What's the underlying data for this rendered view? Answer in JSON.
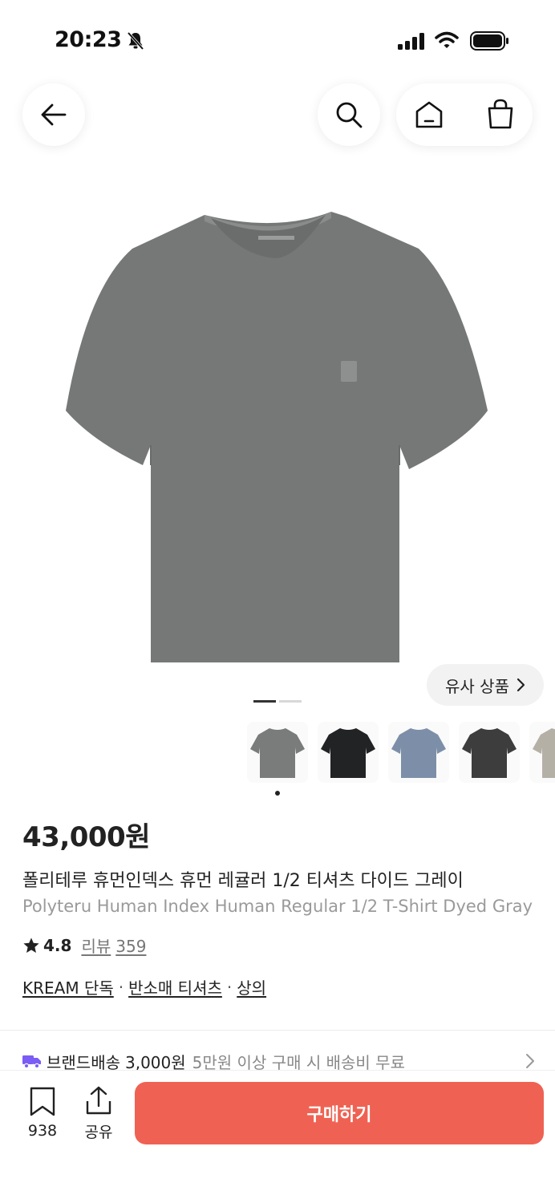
{
  "status_bar": {
    "time": "20:23"
  },
  "header": {
    "back_icon": "arrow-left-icon",
    "search_icon": "search-icon",
    "home_icon": "home-icon",
    "bag_icon": "shopping-bag-icon"
  },
  "gallery": {
    "similar_label": "유사 상품",
    "pages": 2,
    "current_page": 1,
    "thumbnail_colors": [
      "#7a7b7b",
      "#222325",
      "#7d8fa8",
      "#3d3d3e",
      "#b5b0a6"
    ]
  },
  "product": {
    "price": "43,000원",
    "name_ko": "폴리테루 휴먼인덱스 휴먼 레귤러 1/2 티셔츠 다이드 그레이",
    "name_en": "Polyteru Human Index Human Regular 1/2 T-Shirt Dyed Gray",
    "rating": "4.8",
    "reviews_label": "리뷰",
    "reviews_count": "359",
    "tags": [
      "KREAM 단독",
      "반소매 티셔츠",
      "상의"
    ]
  },
  "shipping": {
    "label": "브랜드배송",
    "fee": "3,000원",
    "note": "5만원 이상 구매 시 배송비 무료"
  },
  "bottom_bar": {
    "bookmark_count": "938",
    "share_label": "공유",
    "buy_label": "구매하기"
  },
  "colors": {
    "buy_button": "#ef6253",
    "shirt": "#767878",
    "shipping_truck": "#7b5cf5"
  }
}
